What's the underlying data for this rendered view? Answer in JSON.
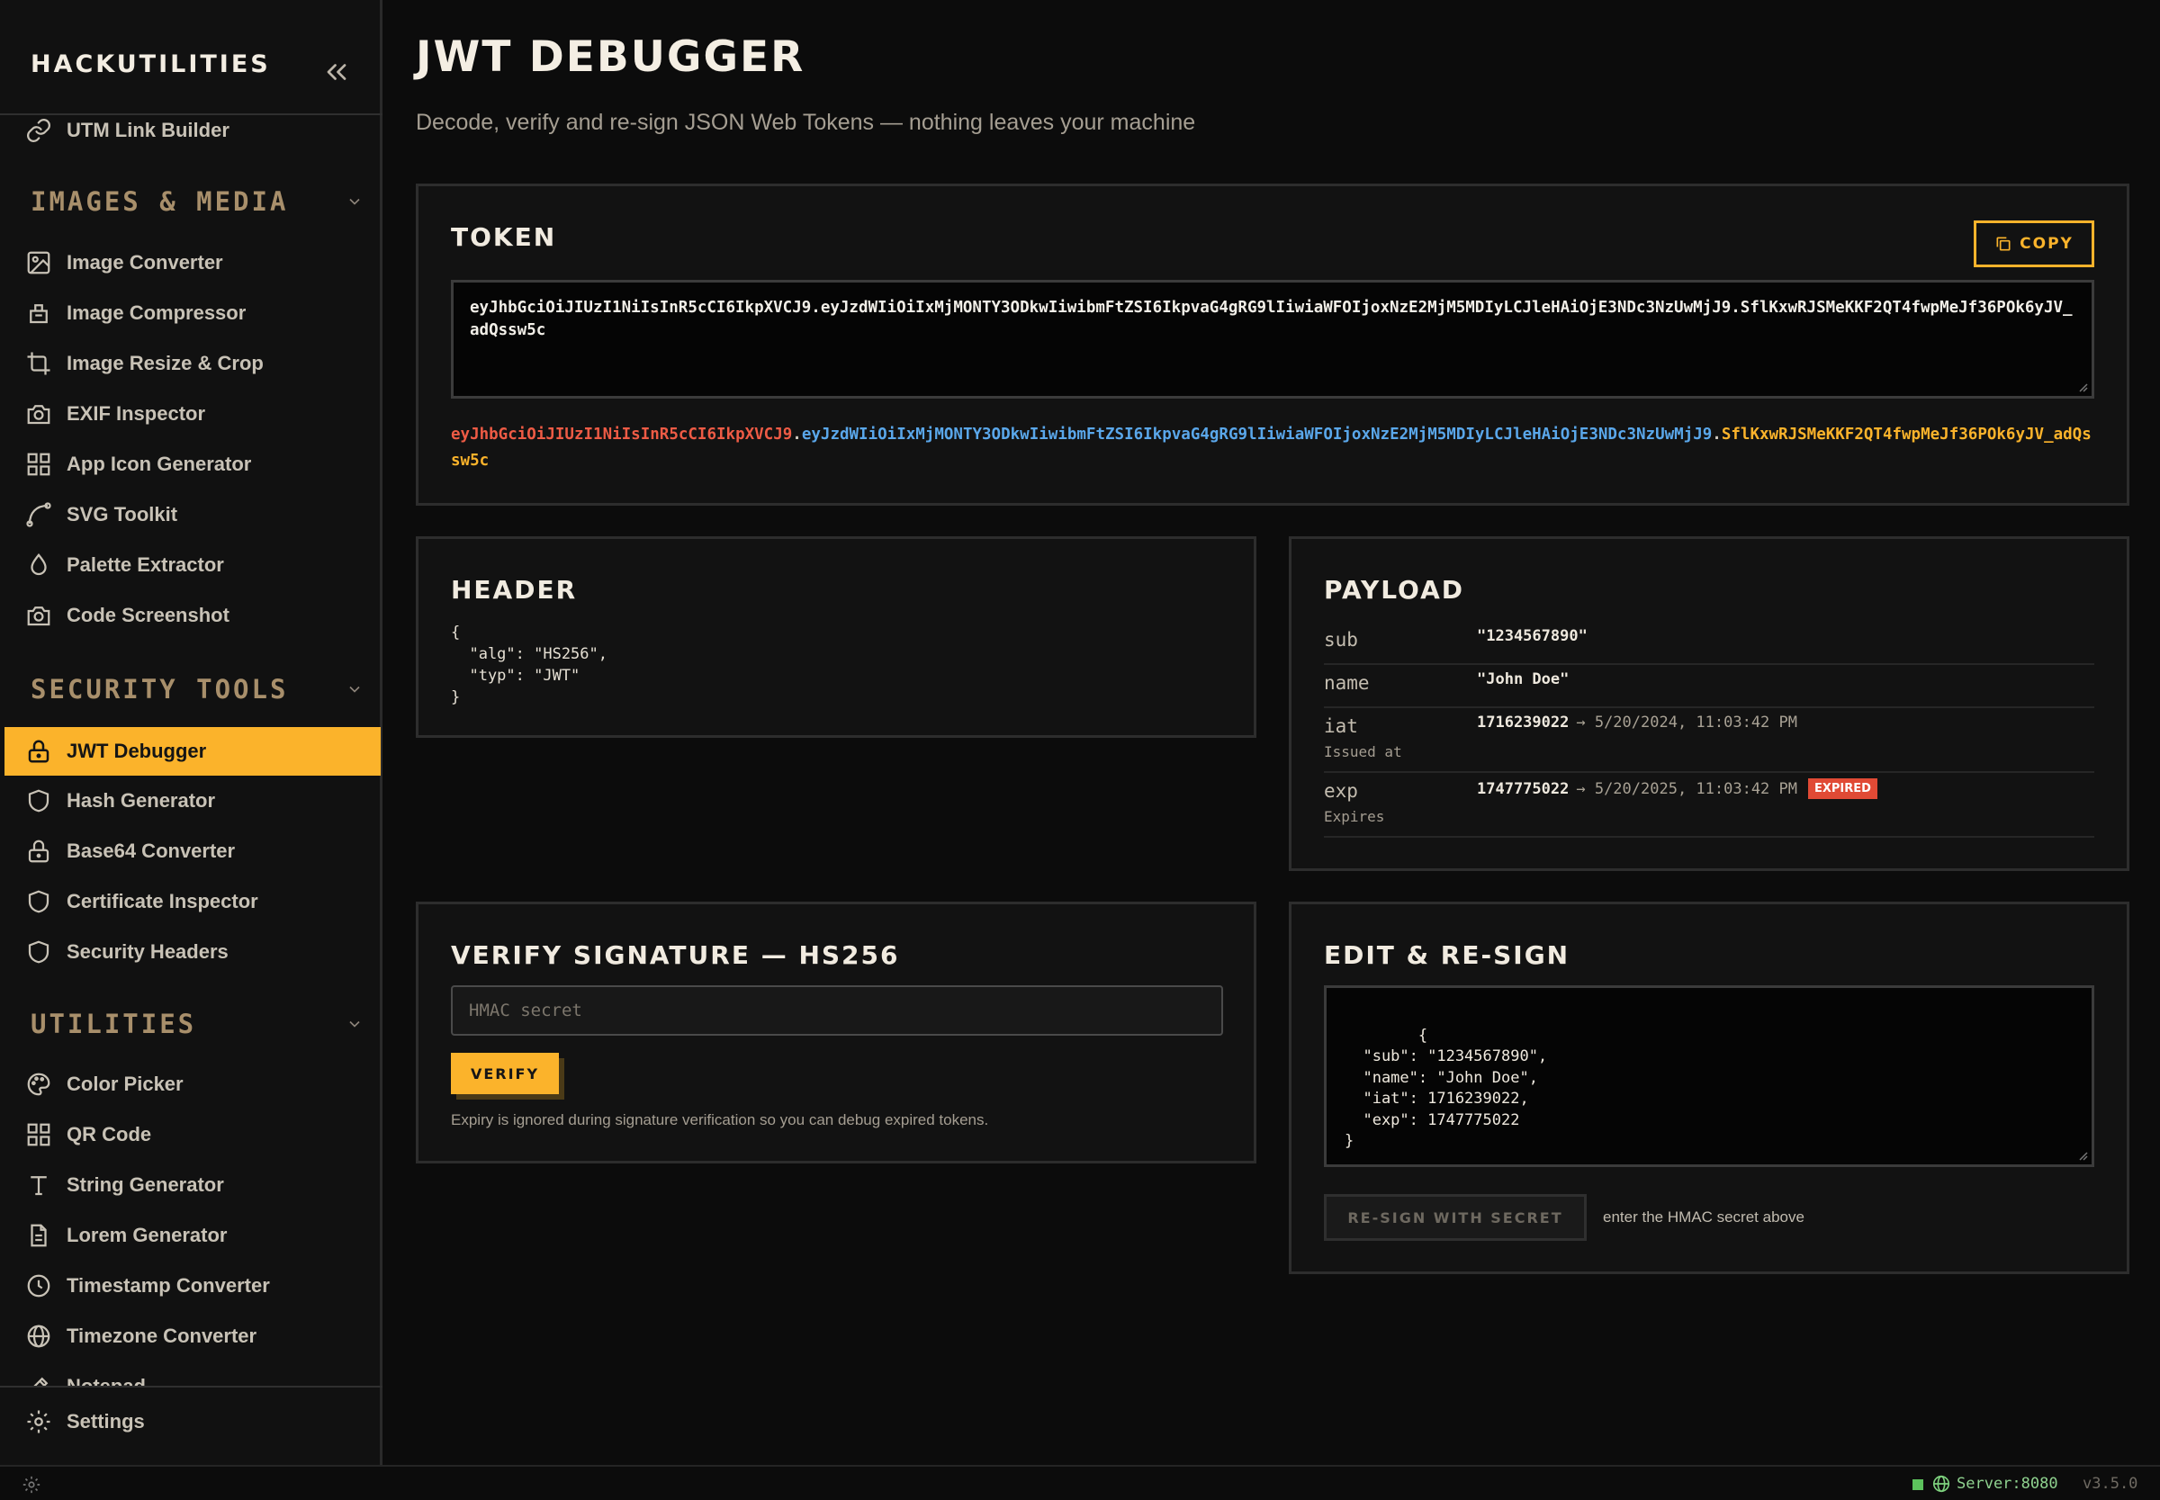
{
  "sidebar": {
    "brand": "HACKUTILITIES",
    "partial_top_item": "UTM Link Builder",
    "sections": [
      {
        "title": "IMAGES & MEDIA",
        "items": [
          {
            "label": "Image Converter",
            "icon": "image-icon"
          },
          {
            "label": "Image Compressor",
            "icon": "compress-icon"
          },
          {
            "label": "Image Resize & Crop",
            "icon": "crop-icon"
          },
          {
            "label": "EXIF Inspector",
            "icon": "camera-icon"
          },
          {
            "label": "App Icon Generator",
            "icon": "grid-icon"
          },
          {
            "label": "SVG Toolkit",
            "icon": "bezier-icon"
          },
          {
            "label": "Palette Extractor",
            "icon": "droplet-icon"
          },
          {
            "label": "Code Screenshot",
            "icon": "camera-icon"
          }
        ]
      },
      {
        "title": "SECURITY TOOLS",
        "items": [
          {
            "label": "JWT Debugger",
            "icon": "lock-icon",
            "active": true
          },
          {
            "label": "Hash Generator",
            "icon": "shield-icon"
          },
          {
            "label": "Base64 Converter",
            "icon": "lock-icon"
          },
          {
            "label": "Certificate Inspector",
            "icon": "shield-icon"
          },
          {
            "label": "Security Headers",
            "icon": "shield-icon"
          }
        ]
      },
      {
        "title": "UTILITIES",
        "items": [
          {
            "label": "Color Picker",
            "icon": "palette-icon"
          },
          {
            "label": "QR Code",
            "icon": "grid-icon"
          },
          {
            "label": "String Generator",
            "icon": "type-icon"
          },
          {
            "label": "Lorem Generator",
            "icon": "file-icon"
          },
          {
            "label": "Timestamp Converter",
            "icon": "clock-icon"
          },
          {
            "label": "Timezone Converter",
            "icon": "globe-icon"
          },
          {
            "label": "Notepad",
            "icon": "edit-icon"
          }
        ]
      }
    ],
    "settings_label": "Settings"
  },
  "page": {
    "title": "JWT DEBUGGER",
    "subtitle": "Decode, verify and re-sign JSON Web Tokens — nothing leaves your machine"
  },
  "token": {
    "title": "TOKEN",
    "copy_label": "COPY",
    "value": "eyJhbGciOiJIUzI1NiIsInR5cCI6IkpXVCJ9.eyJzdWIiOiIxMjMONTY3ODkwIiwibmFtZSI6IkpvaG4gRG9lIiwiaWFOIjoxNzE2MjM5MDIyLCJleHAiOjE3NDc3NzUwMjJ9.SflKxwRJSMeKKF2QT4fwpMeJf36POk6yJV_adQssw5c",
    "header_segment": "eyJhbGciOiJIUzI1NiIsInR5cCI6IkpXVCJ9",
    "payload_segment": "eyJzdWIiOiIxMjMONTY3ODkwIiwibmFtZSI6IkpvaG4gRG9lIiwiaWFOIjoxNzE2MjM5MDIyLCJleHAiOjE3NDc3NzUwMjJ9",
    "signature_segment": "SflKxwRJSMeKKF2QT4fwpMeJf36POk6yJV_adQssw5c",
    "dot": ".",
    "colors": {
      "header": "#ee5b45",
      "payload": "#5aa7ea",
      "signature": "#fbb32b"
    }
  },
  "header_card": {
    "title": "HEADER",
    "json": "{\n  \"alg\": \"HS256\",\n  \"typ\": \"JWT\"\n}"
  },
  "payload_card": {
    "title": "PAYLOAD",
    "claims": [
      {
        "key": "sub",
        "desc": "",
        "value": "\"1234567890\"",
        "human": "",
        "badge": ""
      },
      {
        "key": "name",
        "desc": "",
        "value": "\"John Doe\"",
        "human": "",
        "badge": ""
      },
      {
        "key": "iat",
        "desc": "Issued at",
        "value": "1716239022",
        "human": "→ 5/20/2024, 11:03:42 PM",
        "badge": ""
      },
      {
        "key": "exp",
        "desc": "Expires",
        "value": "1747775022",
        "human": "→ 5/20/2025, 11:03:42 PM",
        "badge": "EXPIRED"
      }
    ]
  },
  "verify_card": {
    "title": "VERIFY SIGNATURE — HS256",
    "placeholder": "HMAC secret",
    "verify_label": "VERIFY",
    "note": "Expiry is ignored during signature verification so you can debug expired tokens."
  },
  "edit_card": {
    "title": "EDIT & RE-SIGN",
    "json": "{\n  \"sub\": \"1234567890\",\n  \"name\": \"John Doe\",\n  \"iat\": 1716239022,\n  \"exp\": 1747775022\n}",
    "resign_label": "RE-SIGN WITH SECRET",
    "note": "enter the HMAC secret above"
  },
  "status": {
    "server": "Server:8080",
    "version": "v3.5.0",
    "accent": "#fbb32b"
  }
}
